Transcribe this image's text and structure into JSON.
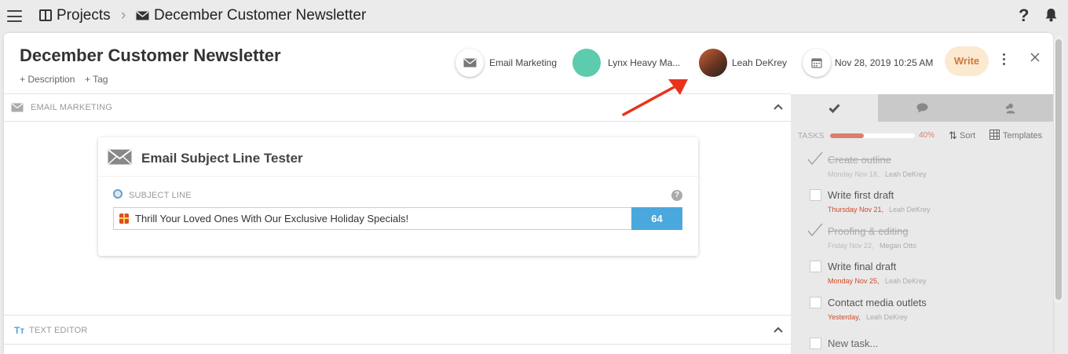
{
  "topbar": {
    "projects_label": "Projects",
    "separator": "›",
    "project_title": "December Customer Newsletter",
    "help_label": "?"
  },
  "header": {
    "title": "December Customer Newsletter",
    "add_description": "+ Description",
    "add_tag": "+ Tag",
    "category": "Email Marketing",
    "workspace": "Lynx Heavy Ma...",
    "assignee": "Leah DeKrey",
    "due_datetime": "Nov 28, 2019 10:25 AM",
    "write_button": "Write"
  },
  "sections": {
    "email_marketing": "EMAIL MARKETING",
    "text_editor": "TEXT EDITOR"
  },
  "subject_tester": {
    "title": "Email Subject Line Tester",
    "field_label": "SUBJECT LINE",
    "help": "?",
    "subject": "Thrill Your Loved Ones With Our Exclusive Holiday Specials!",
    "score": "64"
  },
  "tasks_panel": {
    "label": "TASKS",
    "progress_fraction": 0.4,
    "progress_text": "40%",
    "sort_label": "Sort",
    "templates_label": "Templates",
    "items": [
      {
        "title": "Create outline",
        "due": "Monday Nov 18,",
        "assignee": "Leah DeKrey",
        "done": true,
        "overdue": false
      },
      {
        "title": "Write first draft",
        "due": "Thursday Nov 21,",
        "assignee": "Leah DeKrey",
        "done": false,
        "overdue": true
      },
      {
        "title": "Proofing & editing",
        "due": "Friday Nov 22,",
        "assignee": "Megan Otto",
        "done": true,
        "overdue": false
      },
      {
        "title": "Write final draft",
        "due": "Monday Nov 25,",
        "assignee": "Leah DeKrey",
        "done": false,
        "overdue": true
      },
      {
        "title": "Contact media outlets",
        "due": "Yesterday,",
        "assignee": "Leah DeKrey",
        "done": false,
        "overdue": true
      }
    ],
    "new_task_placeholder": "New task..."
  },
  "colors": {
    "accent_blue": "#4aa8dc",
    "write_bg": "#fbe9d2",
    "write_text": "#d2783a",
    "workspace_dot": "#5ccbae",
    "overdue_red": "#d04a2a",
    "annotation_arrow": "#e8321e"
  },
  "icons": {
    "menu": "hamburger-icon",
    "projects": "projects-icon",
    "email": "envelope-icon",
    "calendar": "calendar-icon",
    "bell": "bell-icon",
    "close": "close-icon",
    "tasks_tab": "checkmark-icon",
    "comments_tab": "speech-bubble-icon",
    "people_tab": "people-icon"
  }
}
